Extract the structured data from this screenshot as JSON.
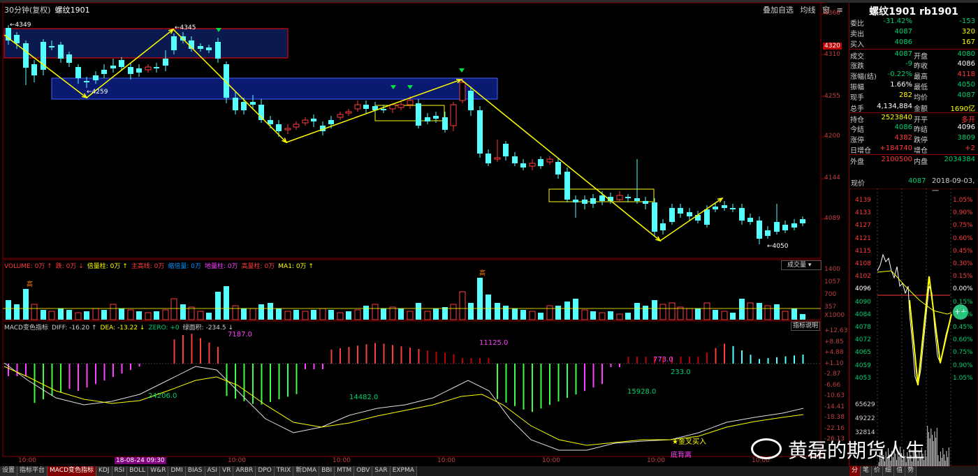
{
  "window": {
    "title_label": "30分钟(复权)",
    "symbol": "螺纹1901"
  },
  "main_controls": [
    "叠加自选",
    "均线",
    "窗",
    "≡"
  ],
  "y_axis": {
    "main": [
      "4366",
      "4320",
      "4310",
      "4255",
      "4200",
      "4144",
      "4089"
    ],
    "volume": [
      "1400",
      "1057",
      "700",
      "357",
      "X1000"
    ],
    "macd": [
      "+12.63",
      "+8.85",
      "+4.88",
      "+1.10",
      "-2.87",
      "-6.66",
      "-10.63",
      "-14.41",
      "-18.38",
      "-22.16",
      "-26.13"
    ]
  },
  "price_annotations": [
    "←4349",
    "←4345",
    "←4259",
    "←4050"
  ],
  "volume_header": [
    {
      "text": "VOLUME: 0万 ↑",
      "color": "#ff3c3c"
    },
    {
      "text": "跌: 0万 ↓",
      "color": "#ff3c3c"
    },
    {
      "text": "倍量柱: 0万 ↑",
      "color": "#ffff00"
    },
    {
      "text": "主高线: 0万",
      "color": "#ff3c3c"
    },
    {
      "text": "缩倍量: 0万",
      "color": "#0090ff"
    },
    {
      "text": "地量柱: 0万",
      "color": "#ff40ff"
    },
    {
      "text": "高量柱: 0万",
      "color": "#ff3c3c"
    },
    {
      "text": "MA1: 0万 ↑",
      "color": "#ffff00"
    }
  ],
  "volume_control": "成交量 ▾",
  "macd_header": [
    {
      "text": "MACD变色指标",
      "color": "#d0d0d0"
    },
    {
      "text": "DIFF: -16.20 ↑",
      "color": "#d0d0d0"
    },
    {
      "text": "DEA: -13.22 ↓",
      "color": "#ffff00"
    },
    {
      "text": "ZERO: +0",
      "color": "#00d070"
    },
    {
      "text": "绿面积: -234.5 ↓",
      "color": "#d0d0d0"
    }
  ],
  "macd_control": "指标说明",
  "macd_annotations": [
    "7187.0",
    "11125.0",
    "24206.0",
    "14482.0",
    "15928.0",
    "773.0",
    "233.0",
    "金叉买入",
    "底背离"
  ],
  "vol_marks": [
    "高"
  ],
  "x_axis": [
    "10:00",
    "18-08-24 09:30",
    "10:00",
    "10:00",
    "10:00",
    "10:00",
    "10:00",
    "10:00"
  ],
  "tabs": [
    "设置",
    "指标平台",
    "MACD变色指标",
    "KDJ",
    "RSI",
    "BOLL",
    "W&R",
    "DMI",
    "BIAS",
    "ASI",
    "VR",
    "ARBR",
    "DPO",
    "TRIX",
    "新DMA",
    "BBI",
    "MTM",
    "OBV",
    "SAR",
    "EXPMA"
  ],
  "right_panel": {
    "title": "螺纹1901  rb1901",
    "rows": [
      {
        "l1": "委比",
        "v1": "-31.42%",
        "c1": "green",
        "l2": "",
        "v2": "-153",
        "c2": "green"
      },
      {
        "l1": "卖出",
        "v1": "4087",
        "c1": "green",
        "l2": "",
        "v2": "320",
        "c2": "yellow"
      },
      {
        "l1": "买入",
        "v1": "4086",
        "c1": "green",
        "l2": "",
        "v2": "167",
        "c2": "yellow"
      },
      {
        "l1": "成交",
        "v1": "4087",
        "c1": "green",
        "l2": "开盘",
        "v2": "4080",
        "c2": "green"
      },
      {
        "l1": "涨跌",
        "v1": "-9",
        "c1": "green",
        "l2": "昨收",
        "v2": "4086",
        "c2": "white"
      },
      {
        "l1": "涨幅(结)",
        "v1": "-0.22%",
        "c1": "green",
        "l2": "最高",
        "v2": "4118",
        "c2": "red"
      },
      {
        "l1": "振幅",
        "v1": "1.66%",
        "c1": "white",
        "l2": "最低",
        "v2": "4050",
        "c2": "green"
      },
      {
        "l1": "现手",
        "v1": "282",
        "c1": "yellow",
        "l2": "均价",
        "v2": "4087",
        "c2": "green"
      },
      {
        "l1": "总手",
        "v1": "4,134,884",
        "c1": "white",
        "l2": "金额",
        "v2": "1690亿",
        "c2": "yellow"
      },
      {
        "l1": "持仓",
        "v1": "2523840",
        "c1": "yellow",
        "l2": "开平",
        "v2": "多开",
        "c2": "red"
      },
      {
        "l1": "今结",
        "v1": "4086",
        "c1": "green",
        "l2": "昨结",
        "v2": "4096",
        "c2": "white"
      },
      {
        "l1": "涨停",
        "v1": "4382",
        "c1": "red",
        "l2": "跌停",
        "v2": "3809",
        "c2": "green"
      },
      {
        "l1": "日增仓",
        "v1": "+184740",
        "c1": "red",
        "l2": "增仓",
        "v2": "+2",
        "c2": "red"
      },
      {
        "l1": "外盘",
        "v1": "2100500",
        "c1": "red",
        "l2": "内盘",
        "v2": "2034384",
        "c2": "green"
      }
    ],
    "mini_header": {
      "label": "现价",
      "price": "4087",
      "time": "2018-09-03,一"
    },
    "mini_y_left": [
      "4139",
      "4133",
      "4127",
      "4121",
      "4115",
      "4108",
      "4102",
      "4096",
      "4090",
      "4084",
      "4078",
      "4072",
      "4065",
      "4059",
      "4053",
      "65629",
      "49222",
      "32814"
    ],
    "mini_y_right": [
      "1.05%",
      "0.90%",
      "0.75%",
      "0.60%",
      "0.45%",
      "0.30%",
      "0.15%",
      "0.00%",
      "0.15%",
      "0.30%",
      "0.45%",
      "0.60%",
      "0.75%",
      "0.90%",
      "1.05%"
    ],
    "tabs": [
      "分",
      "笔",
      "价",
      "细",
      "值",
      "势"
    ],
    "float_button": "++"
  },
  "watermark": "黄磊的期货人生"
}
